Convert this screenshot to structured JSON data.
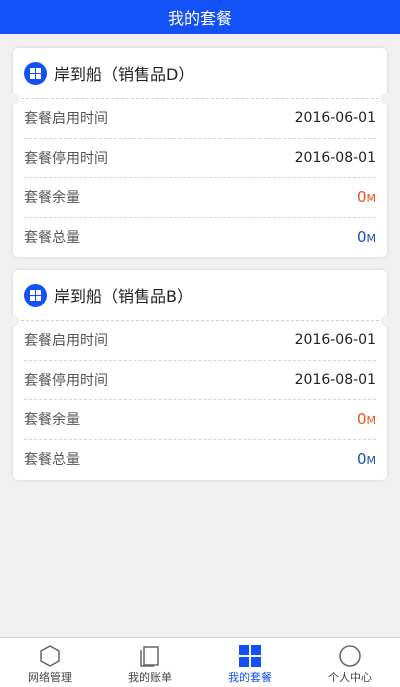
{
  "header": {
    "title": "我的套餐"
  },
  "plans": [
    {
      "title": "岸到船（销售品D）",
      "rows": [
        {
          "label": "套餐启用时间",
          "value": "2016-06-01"
        },
        {
          "label": "套餐停用时间",
          "value": "2016-08-01"
        },
        {
          "label": "套餐余量",
          "value": "0",
          "unit": "M"
        },
        {
          "label": "套餐总量",
          "value": "0",
          "unit": "M"
        }
      ]
    },
    {
      "title": "岸到船（销售品B）",
      "rows": [
        {
          "label": "套餐启用时间",
          "value": "2016-06-01"
        },
        {
          "label": "套餐停用时间",
          "value": "2016-08-01"
        },
        {
          "label": "套餐余量",
          "value": "0",
          "unit": "M"
        },
        {
          "label": "套餐总量",
          "value": "0",
          "unit": "M"
        }
      ]
    }
  ],
  "tabbar": {
    "tabs": [
      {
        "label": "网络管理",
        "icon": "hexagon-icon"
      },
      {
        "label": "我的账单",
        "icon": "document-icon"
      },
      {
        "label": "我的套餐",
        "icon": "grid-icon",
        "active": true
      },
      {
        "label": "个人中心",
        "icon": "circle-user-icon"
      }
    ]
  },
  "colors": {
    "primary": "#1251f5",
    "remain": "#e8521d",
    "total": "#1a4fb0"
  }
}
